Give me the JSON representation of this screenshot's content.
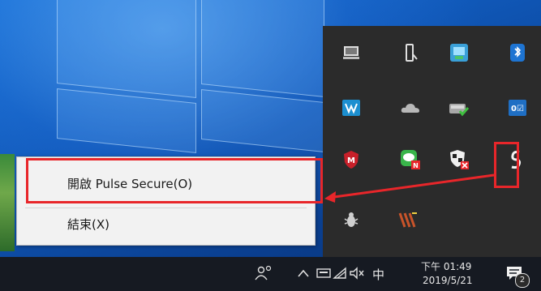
{
  "context_menu": {
    "items": [
      {
        "label": "開啟 Pulse Secure(O)"
      },
      {
        "label": "結束(X)"
      }
    ]
  },
  "tray_overflow": {
    "icons": [
      "network-monitor-icon",
      "usb-drive-icon",
      "remote-app-icon",
      "bluetooth-icon",
      "wireless-icon",
      "onedrive-icon",
      "security-check-icon",
      "outlook-icon",
      "mcafee-icon",
      "line-messenger-icon",
      "windows-defender-icon",
      "pulse-secure-icon",
      "bug-icon",
      "stylus-icon"
    ]
  },
  "taskbar": {
    "people_icon": "people-icon",
    "ime_label": "中",
    "time": "下午 01:49",
    "date": "2019/5/21",
    "notification_count": "2"
  },
  "colors": {
    "highlight": "#e8262a",
    "taskbar": "#161a22",
    "tray_bg": "#2b2b2b",
    "menu_bg": "#f2f2f2"
  }
}
